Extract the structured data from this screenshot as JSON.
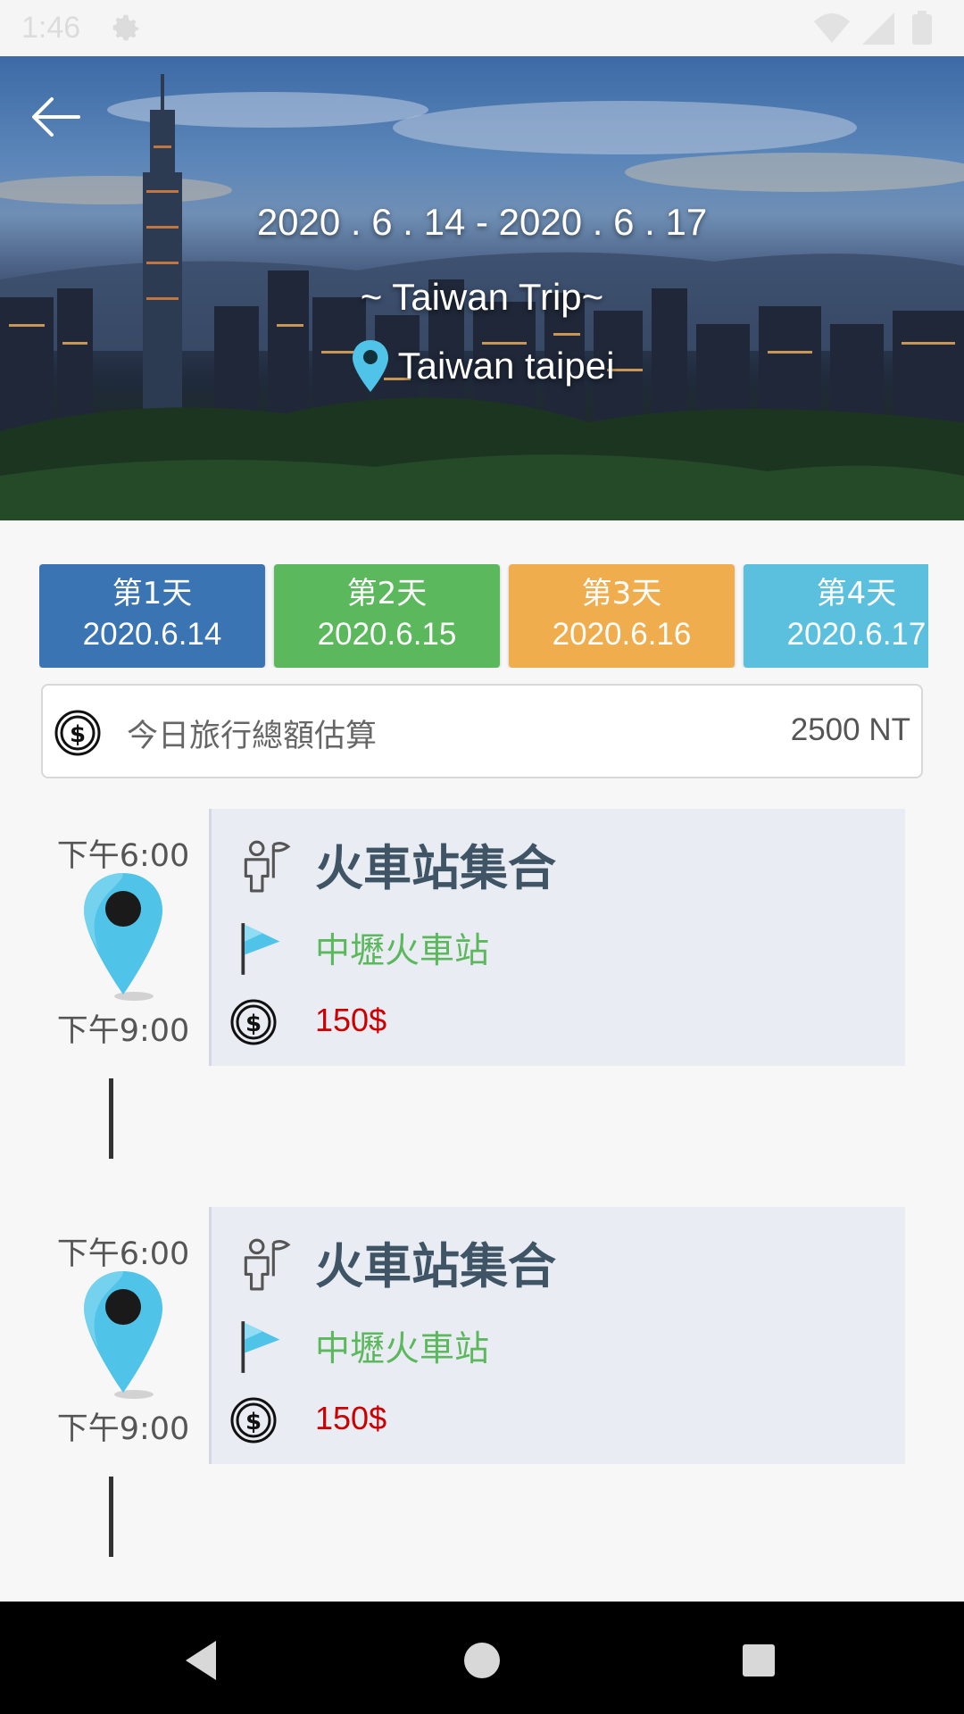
{
  "status_bar": {
    "time": "1:46"
  },
  "header": {
    "dates": "2020 . 6 . 14 - 2020 . 6 . 17",
    "title": "~ Taiwan Trip~",
    "location": "Taiwan taipei"
  },
  "days": [
    {
      "label": "第1天",
      "date": "2020.6.14",
      "color": "#3a74b3"
    },
    {
      "label": "第2天",
      "date": "2020.6.15",
      "color": "#5cb85c"
    },
    {
      "label": "第3天",
      "date": "2020.6.16",
      "color": "#f0ad4e"
    },
    {
      "label": "第4天",
      "date": "2020.6.17",
      "color": "#5bc0de"
    }
  ],
  "total": {
    "label": "今日旅行總額估算",
    "value": "2500 NT"
  },
  "events": [
    {
      "start": "下午6:00",
      "end": "下午9:00",
      "title": "火車站集合",
      "location": "中壢火車站",
      "cost": "150$"
    },
    {
      "start": "下午6:00",
      "end": "下午9:00",
      "title": "火車站集合",
      "location": "中壢火車站",
      "cost": "150$"
    }
  ],
  "icons": {
    "back": "arrow-left-icon",
    "location": "map-pin-icon",
    "money": "dollar-coin-icon",
    "activity": "person-flag-icon",
    "place": "flag-icon"
  }
}
